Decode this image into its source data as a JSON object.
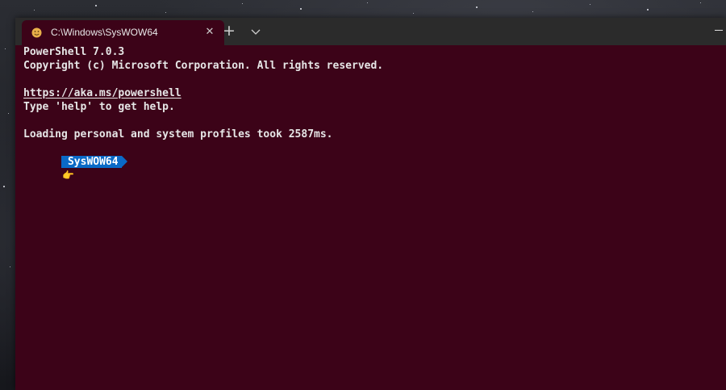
{
  "window": {
    "tab": {
      "title": "C:\\Windows\\SysWOW64",
      "icon": "emoji-face-icon",
      "close_glyph": "✕"
    },
    "new_tab_glyph": "+",
    "dropdown_icon": "chevron-down-icon",
    "minimize_icon": "minimize-icon",
    "background_color": "#3c0318",
    "titlebar_color": "#2b2b2b"
  },
  "console": {
    "lines": [
      "PowerShell 7.0.3",
      "Copyright (c) Microsoft Corporation. All rights reserved.",
      "",
      "https://aka.ms/powershell",
      "Type 'help' to get help.",
      "",
      "Loading personal and system profiles took 2587ms."
    ],
    "prompt": {
      "path": "SysWOW64",
      "segment_color": "#0a6ac7"
    },
    "cursor_glyph": "👉"
  }
}
